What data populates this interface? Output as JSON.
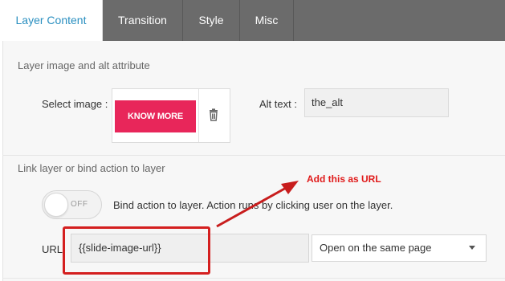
{
  "tabs": [
    {
      "label": "Layer Content",
      "active": true
    },
    {
      "label": "Transition",
      "active": false
    },
    {
      "label": "Style",
      "active": false
    },
    {
      "label": "Misc",
      "active": false
    }
  ],
  "image_section": {
    "title": "Layer image and alt attribute",
    "select_label": "Select image :",
    "preview_text": "KNOW MORE",
    "alt_label": "Alt text :",
    "alt_value": "the_alt"
  },
  "link_section": {
    "title": "Link layer or bind action to layer",
    "toggle_state": "OFF",
    "bind_text": "Bind action to layer. Action runs by clicking user on the layer.",
    "url_label": "URL",
    "url_value": "{{slide-image-url}}",
    "target_option": "Open on the same page"
  },
  "annotation": {
    "text": "Add this as URL",
    "color": "#e01a1a"
  },
  "colors": {
    "tab_bar": "#6b6b6b",
    "active_tab_text": "#2a8fc0",
    "preview_button": "#e8265a",
    "highlight": "#d41f1f"
  }
}
